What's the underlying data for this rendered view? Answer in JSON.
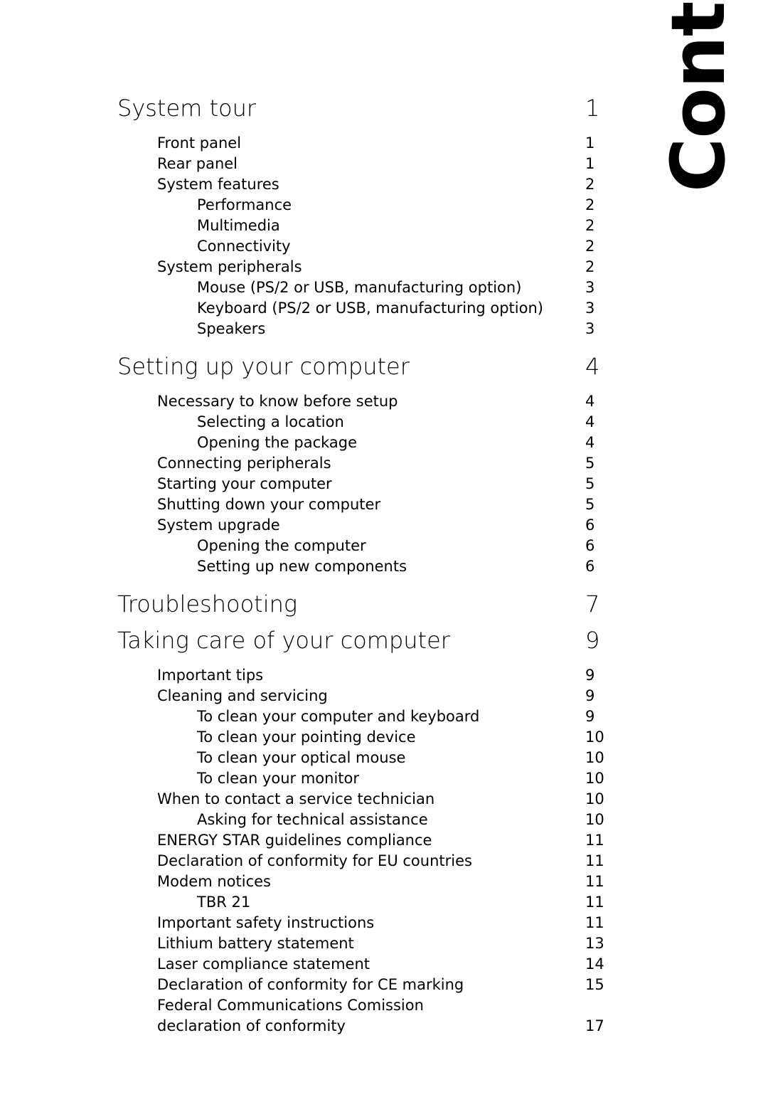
{
  "page": {
    "side_title": "Contents",
    "background_color": "#ffffff",
    "text_color": "#000000"
  },
  "toc": {
    "entries": [
      {
        "level": "heading",
        "label": "System tour",
        "page": "1"
      },
      {
        "level": "lvl1",
        "label": "Front panel",
        "page": "1"
      },
      {
        "level": "lvl1",
        "label": "Rear panel",
        "page": "1"
      },
      {
        "level": "lvl1",
        "label": "System features",
        "page": "2"
      },
      {
        "level": "lvl2",
        "label": "Performance",
        "page": "2"
      },
      {
        "level": "lvl2",
        "label": "Multimedia",
        "page": "2"
      },
      {
        "level": "lvl2",
        "label": "Connectivity",
        "page": "2"
      },
      {
        "level": "lvl1",
        "label": "System peripherals",
        "page": "2"
      },
      {
        "level": "lvl2",
        "label": "Mouse (PS/2 or USB, manufacturing option)",
        "page": "3"
      },
      {
        "level": "lvl2",
        "label": "Keyboard (PS/2 or USB, manufacturing option)",
        "page": "3"
      },
      {
        "level": "lvl2",
        "label": "Speakers",
        "page": "3"
      },
      {
        "level": "heading",
        "label": "Setting up your computer",
        "page": "4"
      },
      {
        "level": "lvl1",
        "label": "Necessary to know before setup",
        "page": "4"
      },
      {
        "level": "lvl2",
        "label": "Selecting a location",
        "page": "4"
      },
      {
        "level": "lvl2",
        "label": "Opening the package",
        "page": "4"
      },
      {
        "level": "lvl1",
        "label": "Connecting peripherals",
        "page": "5"
      },
      {
        "level": "lvl1",
        "label": "Starting your computer",
        "page": "5"
      },
      {
        "level": "lvl1",
        "label": "Shutting down your computer",
        "page": "5"
      },
      {
        "level": "lvl1",
        "label": "System upgrade",
        "page": "6"
      },
      {
        "level": "lvl2",
        "label": "Opening the computer",
        "page": "6"
      },
      {
        "level": "lvl2",
        "label": "Setting up new components",
        "page": "6"
      },
      {
        "level": "heading",
        "label": "Troubleshooting",
        "page": "7"
      },
      {
        "level": "heading",
        "label": "Taking care of your computer",
        "page": "9"
      },
      {
        "level": "lvl1",
        "label": "Important tips",
        "page": "9"
      },
      {
        "level": "lvl1",
        "label": "Cleaning and servicing",
        "page": "9"
      },
      {
        "level": "lvl2",
        "label": "To clean your computer and keyboard",
        "page": "9"
      },
      {
        "level": "lvl2",
        "label": "To clean your pointing device",
        "page": "10"
      },
      {
        "level": "lvl2",
        "label": "To clean your optical mouse",
        "page": "10"
      },
      {
        "level": "lvl2",
        "label": "To clean your monitor",
        "page": "10"
      },
      {
        "level": "lvl1",
        "label": "When to contact a service technician",
        "page": "10"
      },
      {
        "level": "lvl2",
        "label": "Asking for technical assistance",
        "page": "10"
      },
      {
        "level": "lvl1",
        "label": "ENERGY STAR guidelines compliance",
        "page": "11"
      },
      {
        "level": "lvl1",
        "label": "Declaration of conformity for EU countries",
        "page": "11"
      },
      {
        "level": "lvl1",
        "label": "Modem notices",
        "page": "11"
      },
      {
        "level": "lvl2",
        "label": "TBR 21",
        "page": "11"
      },
      {
        "level": "lvl1",
        "label": "Important safety instructions",
        "page": "11"
      },
      {
        "level": "lvl1",
        "label": "Lithium battery statement",
        "page": "13"
      },
      {
        "level": "lvl1",
        "label": "Laser compliance statement",
        "page": "14"
      },
      {
        "level": "lvl1",
        "label": "Declaration of conformity for CE marking",
        "page": "15"
      },
      {
        "level": "lvl1",
        "label": "Federal Communications Comission",
        "page": ""
      },
      {
        "level": "lvl1",
        "label": "declaration of conformity",
        "page": "17"
      }
    ]
  }
}
